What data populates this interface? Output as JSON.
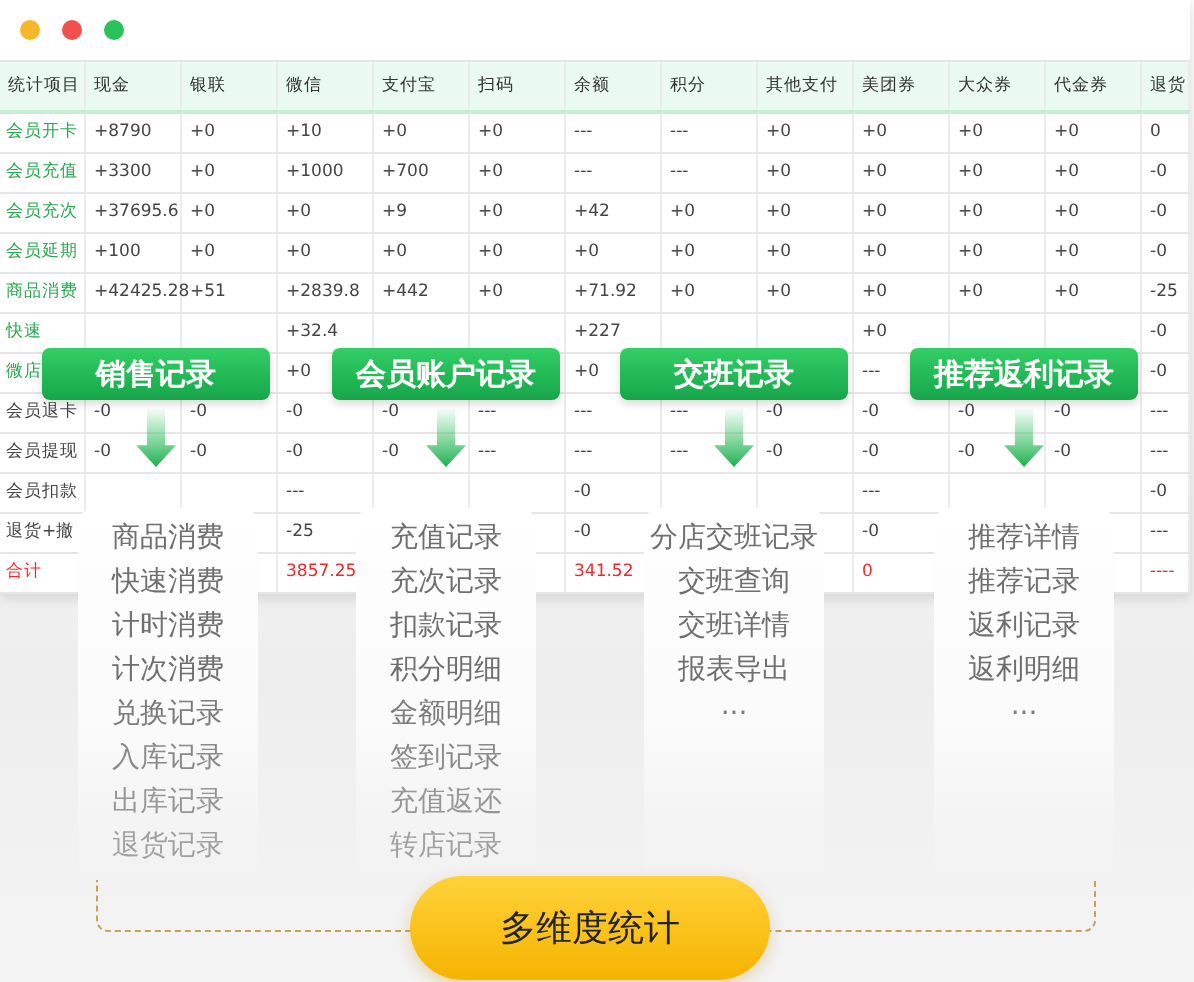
{
  "window": {
    "controls": [
      {
        "color": "#f5b62a"
      },
      {
        "color": "#f2504c"
      },
      {
        "color": "#2cc25a"
      }
    ]
  },
  "table": {
    "columns": [
      "统计项目",
      "现金",
      "银联",
      "微信",
      "支付宝",
      "扫码",
      "余额",
      "积分",
      "其他支付",
      "美团券",
      "大众券",
      "代金券",
      "退货"
    ],
    "rows": [
      {
        "kind": "income",
        "cells": [
          "会员开卡",
          "+8790",
          "+0",
          "+10",
          "+0",
          "+0",
          "---",
          "---",
          "+0",
          "+0",
          "+0",
          "+0",
          "0"
        ]
      },
      {
        "kind": "income",
        "cells": [
          "会员充值",
          "+3300",
          "+0",
          "+1000",
          "+700",
          "+0",
          "---",
          "---",
          "+0",
          "+0",
          "+0",
          "+0",
          "-0"
        ]
      },
      {
        "kind": "income",
        "cells": [
          "会员充次",
          "+37695.6",
          "+0",
          "+0",
          "+9",
          "+0",
          "+42",
          "+0",
          "+0",
          "+0",
          "+0",
          "+0",
          "-0"
        ]
      },
      {
        "kind": "income",
        "cells": [
          "会员延期",
          "+100",
          "+0",
          "+0",
          "+0",
          "+0",
          "+0",
          "+0",
          "+0",
          "+0",
          "+0",
          "+0",
          "-0"
        ]
      },
      {
        "kind": "income",
        "cells": [
          "商品消费",
          "+42425.28",
          "+51",
          "+2839.8",
          "+442",
          "+0",
          "+71.92",
          "+0",
          "+0",
          "+0",
          "+0",
          "+0",
          "-25"
        ]
      },
      {
        "kind": "income",
        "cells": [
          "快速",
          null,
          null,
          "+32.4",
          null,
          null,
          "+227",
          null,
          null,
          "+0",
          null,
          null,
          "-0"
        ]
      },
      {
        "kind": "income",
        "cells": [
          "微店",
          null,
          null,
          "+0",
          null,
          null,
          "+0",
          null,
          null,
          "---",
          null,
          null,
          "-0"
        ]
      },
      {
        "kind": "expense",
        "cells": [
          "会员退卡",
          "-0",
          "-0",
          "-0",
          "-0",
          "---",
          "---",
          "---",
          "-0",
          "-0",
          "-0",
          "-0",
          "---"
        ]
      },
      {
        "kind": "expense",
        "cells": [
          "会员提现",
          "-0",
          "-0",
          "-0",
          "-0",
          "---",
          "---",
          "---",
          "-0",
          "-0",
          "-0",
          "-0",
          "---"
        ]
      },
      {
        "kind": "expense",
        "cells": [
          "会员扣款",
          null,
          null,
          "---",
          null,
          null,
          "-0",
          null,
          null,
          "---",
          null,
          null,
          "-0"
        ]
      },
      {
        "kind": "expense",
        "cells": [
          "退货+撤",
          null,
          null,
          "-25",
          null,
          null,
          "-0",
          null,
          null,
          "-0",
          null,
          null,
          "---"
        ]
      },
      {
        "kind": "total",
        "cells": [
          "合计",
          null,
          null,
          "3857.25",
          null,
          null,
          "341.52",
          null,
          null,
          "0",
          null,
          null,
          "----"
        ]
      }
    ]
  },
  "categories": [
    {
      "title": "销售记录",
      "items": [
        "商品消费",
        "快速消费",
        "计时消费",
        "计次消费",
        "兑换记录",
        "入库记录",
        "出库记录",
        "退货记录"
      ]
    },
    {
      "title": "会员账户记录",
      "items": [
        "充值记录",
        "充次记录",
        "扣款记录",
        "积分明细",
        "金额明细",
        "签到记录",
        "充值返还",
        "转店记录"
      ]
    },
    {
      "title": "交班记录",
      "items": [
        "分店交班记录",
        "交班查询",
        "交班详情",
        "报表导出",
        "···"
      ]
    },
    {
      "title": "推荐返利记录",
      "items": [
        "推荐详情",
        "推荐记录",
        "返利记录",
        "返利明细",
        "···"
      ]
    }
  ],
  "summary_button": {
    "label": "多维度统计"
  }
}
